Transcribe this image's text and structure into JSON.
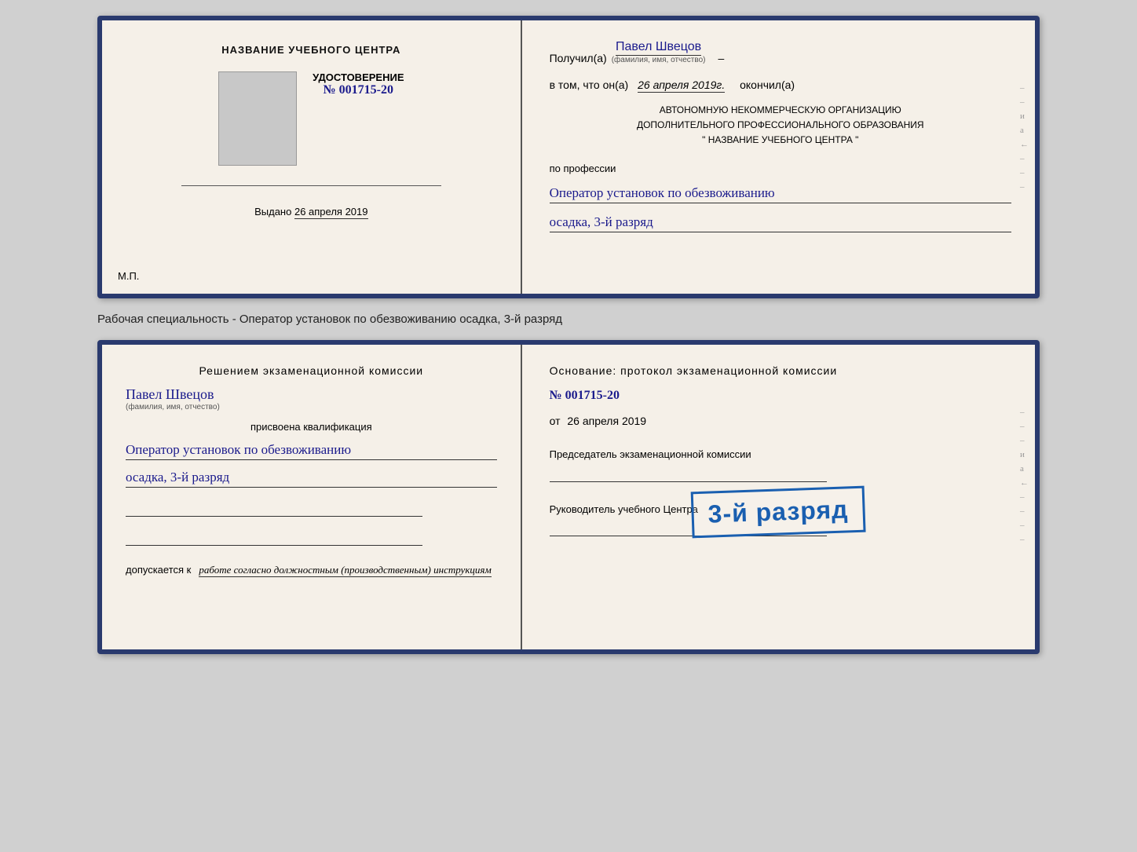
{
  "page": {
    "background_color": "#d0d0d0"
  },
  "first_doc": {
    "left": {
      "title": "НАЗВАНИЕ УЧЕБНОГО ЦЕНТРА",
      "cert_label": "УДОСТОВЕРЕНИЕ",
      "cert_prefix": "№",
      "cert_number": "001715-20",
      "issued_label": "Выдано",
      "issued_date": "26 апреля 2019",
      "mp_label": "М.П."
    },
    "right": {
      "received_prefix": "Получил(а)",
      "recipient_name": "Павел Швецов",
      "name_hint": "(фамилия, имя, отчество)",
      "confirm_prefix": "в том, что он(а)",
      "confirm_date": "26 апреля 2019г.",
      "confirm_suffix": "окончил(а)",
      "org_line1": "АВТОНОМНУЮ НЕКОММЕРЧЕСКУЮ ОРГАНИЗАЦИЮ",
      "org_line2": "ДОПОЛНИТЕЛЬНОГО ПРОФЕССИОНАЛЬНОГО ОБРАЗОВАНИЯ",
      "org_line3": "\"  НАЗВАНИЕ УЧЕБНОГО ЦЕНТРА  \"",
      "profession_label": "по профессии",
      "profession_value": "Оператор установок по обезвоживанию",
      "rank_value": "осадка, 3-й разряд"
    }
  },
  "between_text": "Рабочая специальность - Оператор установок по обезвоживанию осадка, 3-й разряд",
  "second_doc": {
    "left": {
      "decision_title": "Решением  экзаменационной  комиссии",
      "person_name": "Павел Швецов",
      "name_hint": "(фамилия, имя, отчество)",
      "qualification_label": "присвоена квалификация",
      "qualification_value": "Оператор установок по обезвоживанию",
      "qualification_rank": "осадка, 3-й разряд",
      "allowed_prefix": "допускается к",
      "allowed_text": "работе согласно должностным (производственным) инструкциям"
    },
    "right": {
      "basis_title": "Основание: протокол экзаменационной  комиссии",
      "protocol_prefix": "№",
      "protocol_number": "001715-20",
      "date_prefix": "от",
      "protocol_date": "26 апреля 2019",
      "chairman_label": "Председатель экзаменационной комиссии",
      "director_label": "Руководитель учебного Центра"
    },
    "stamp": {
      "text": "3-й разряд"
    }
  },
  "right_margin": {
    "chars": [
      "–",
      "–",
      "и",
      "а",
      "←",
      "–",
      "–",
      "–",
      "–",
      "–"
    ]
  }
}
